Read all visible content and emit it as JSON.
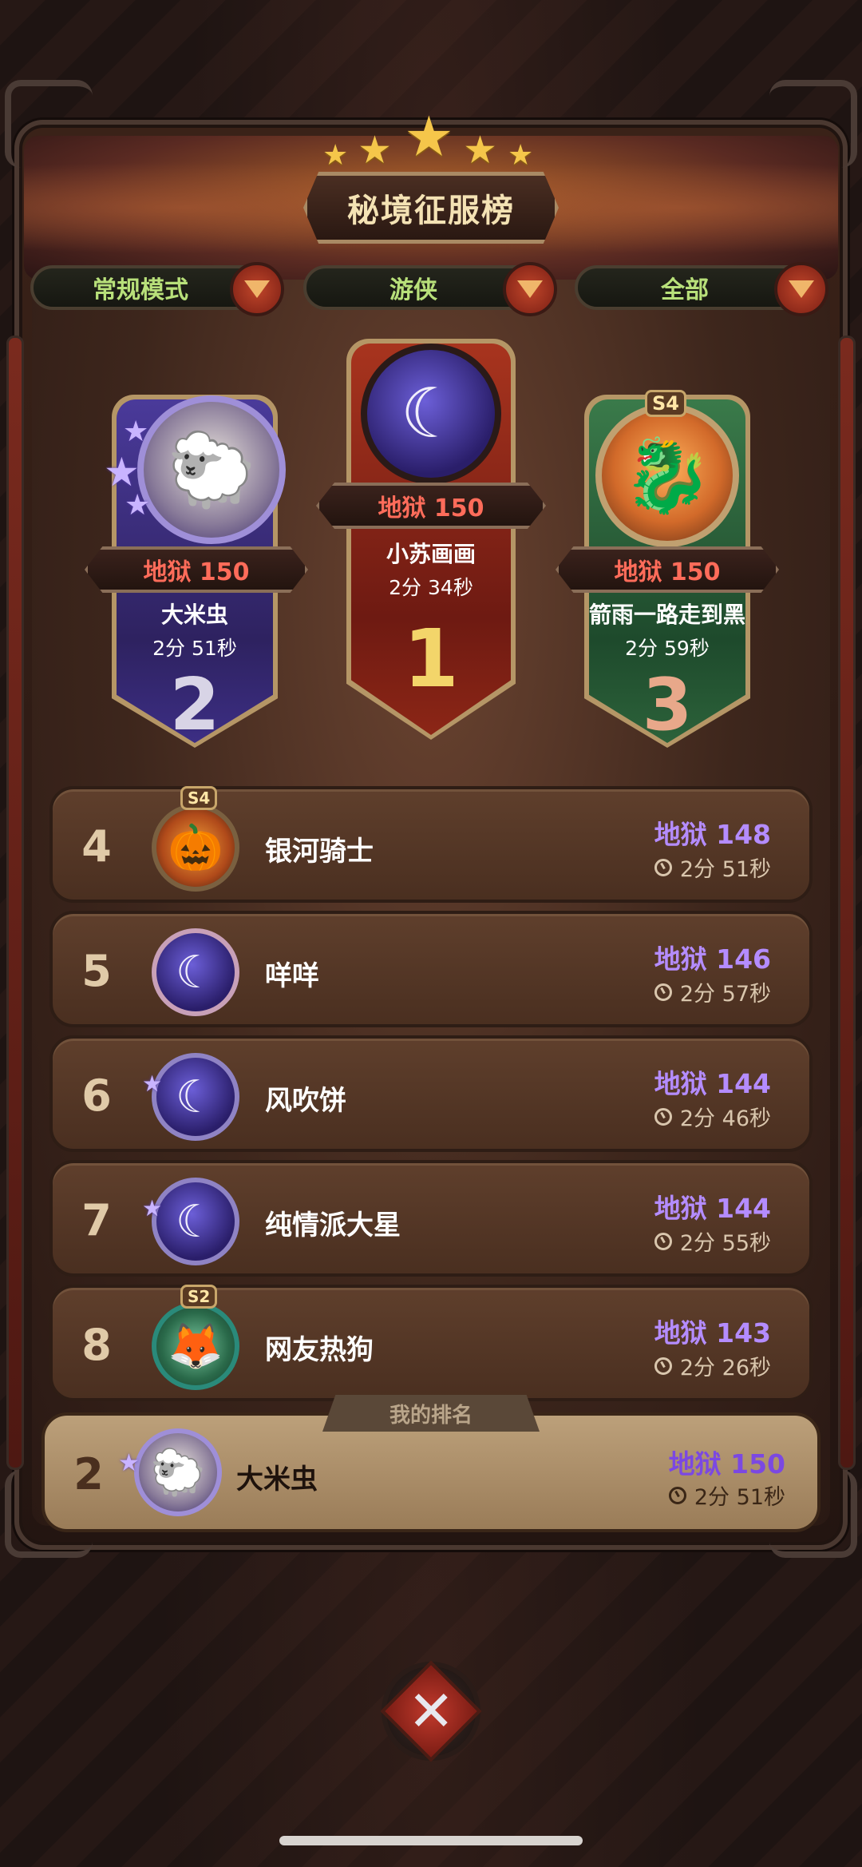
{
  "title": "秘境征服榜",
  "filters": [
    {
      "label": "常规模式"
    },
    {
      "label": "游侠"
    },
    {
      "label": "全部"
    }
  ],
  "podium": {
    "first": {
      "level": "地狱 150",
      "name": "小苏画画",
      "time": "2分 34秒",
      "rank": "1"
    },
    "second": {
      "level": "地狱 150",
      "name": "大米虫",
      "time": "2分 51秒",
      "rank": "2"
    },
    "third": {
      "level": "地狱 150",
      "name": "箭雨一路走到黑",
      "time": "2分 59秒",
      "rank": "3",
      "season": "S4"
    }
  },
  "rows": [
    {
      "rank": "4",
      "name": "银河骑士",
      "level": "地狱 148",
      "time": "2分 51秒",
      "season": "S4"
    },
    {
      "rank": "5",
      "name": "咩咩",
      "level": "地狱 146",
      "time": "2分 57秒"
    },
    {
      "rank": "6",
      "name": "风吹饼",
      "level": "地狱 144",
      "time": "2分 46秒"
    },
    {
      "rank": "7",
      "name": "纯情派大星",
      "level": "地狱 144",
      "time": "2分 55秒"
    },
    {
      "rank": "8",
      "name": "网友热狗",
      "level": "地狱 143",
      "time": "2分 26秒",
      "season": "S2"
    }
  ],
  "my_rank": {
    "tab_label": "我的排名",
    "rank": "2",
    "name": "大米虫",
    "level": "地狱 150",
    "time": "2分 51秒"
  },
  "colors": {
    "level_red": "#ff6c5a",
    "level_purple": "#b48cff",
    "filter_green": "#b8e07a"
  }
}
